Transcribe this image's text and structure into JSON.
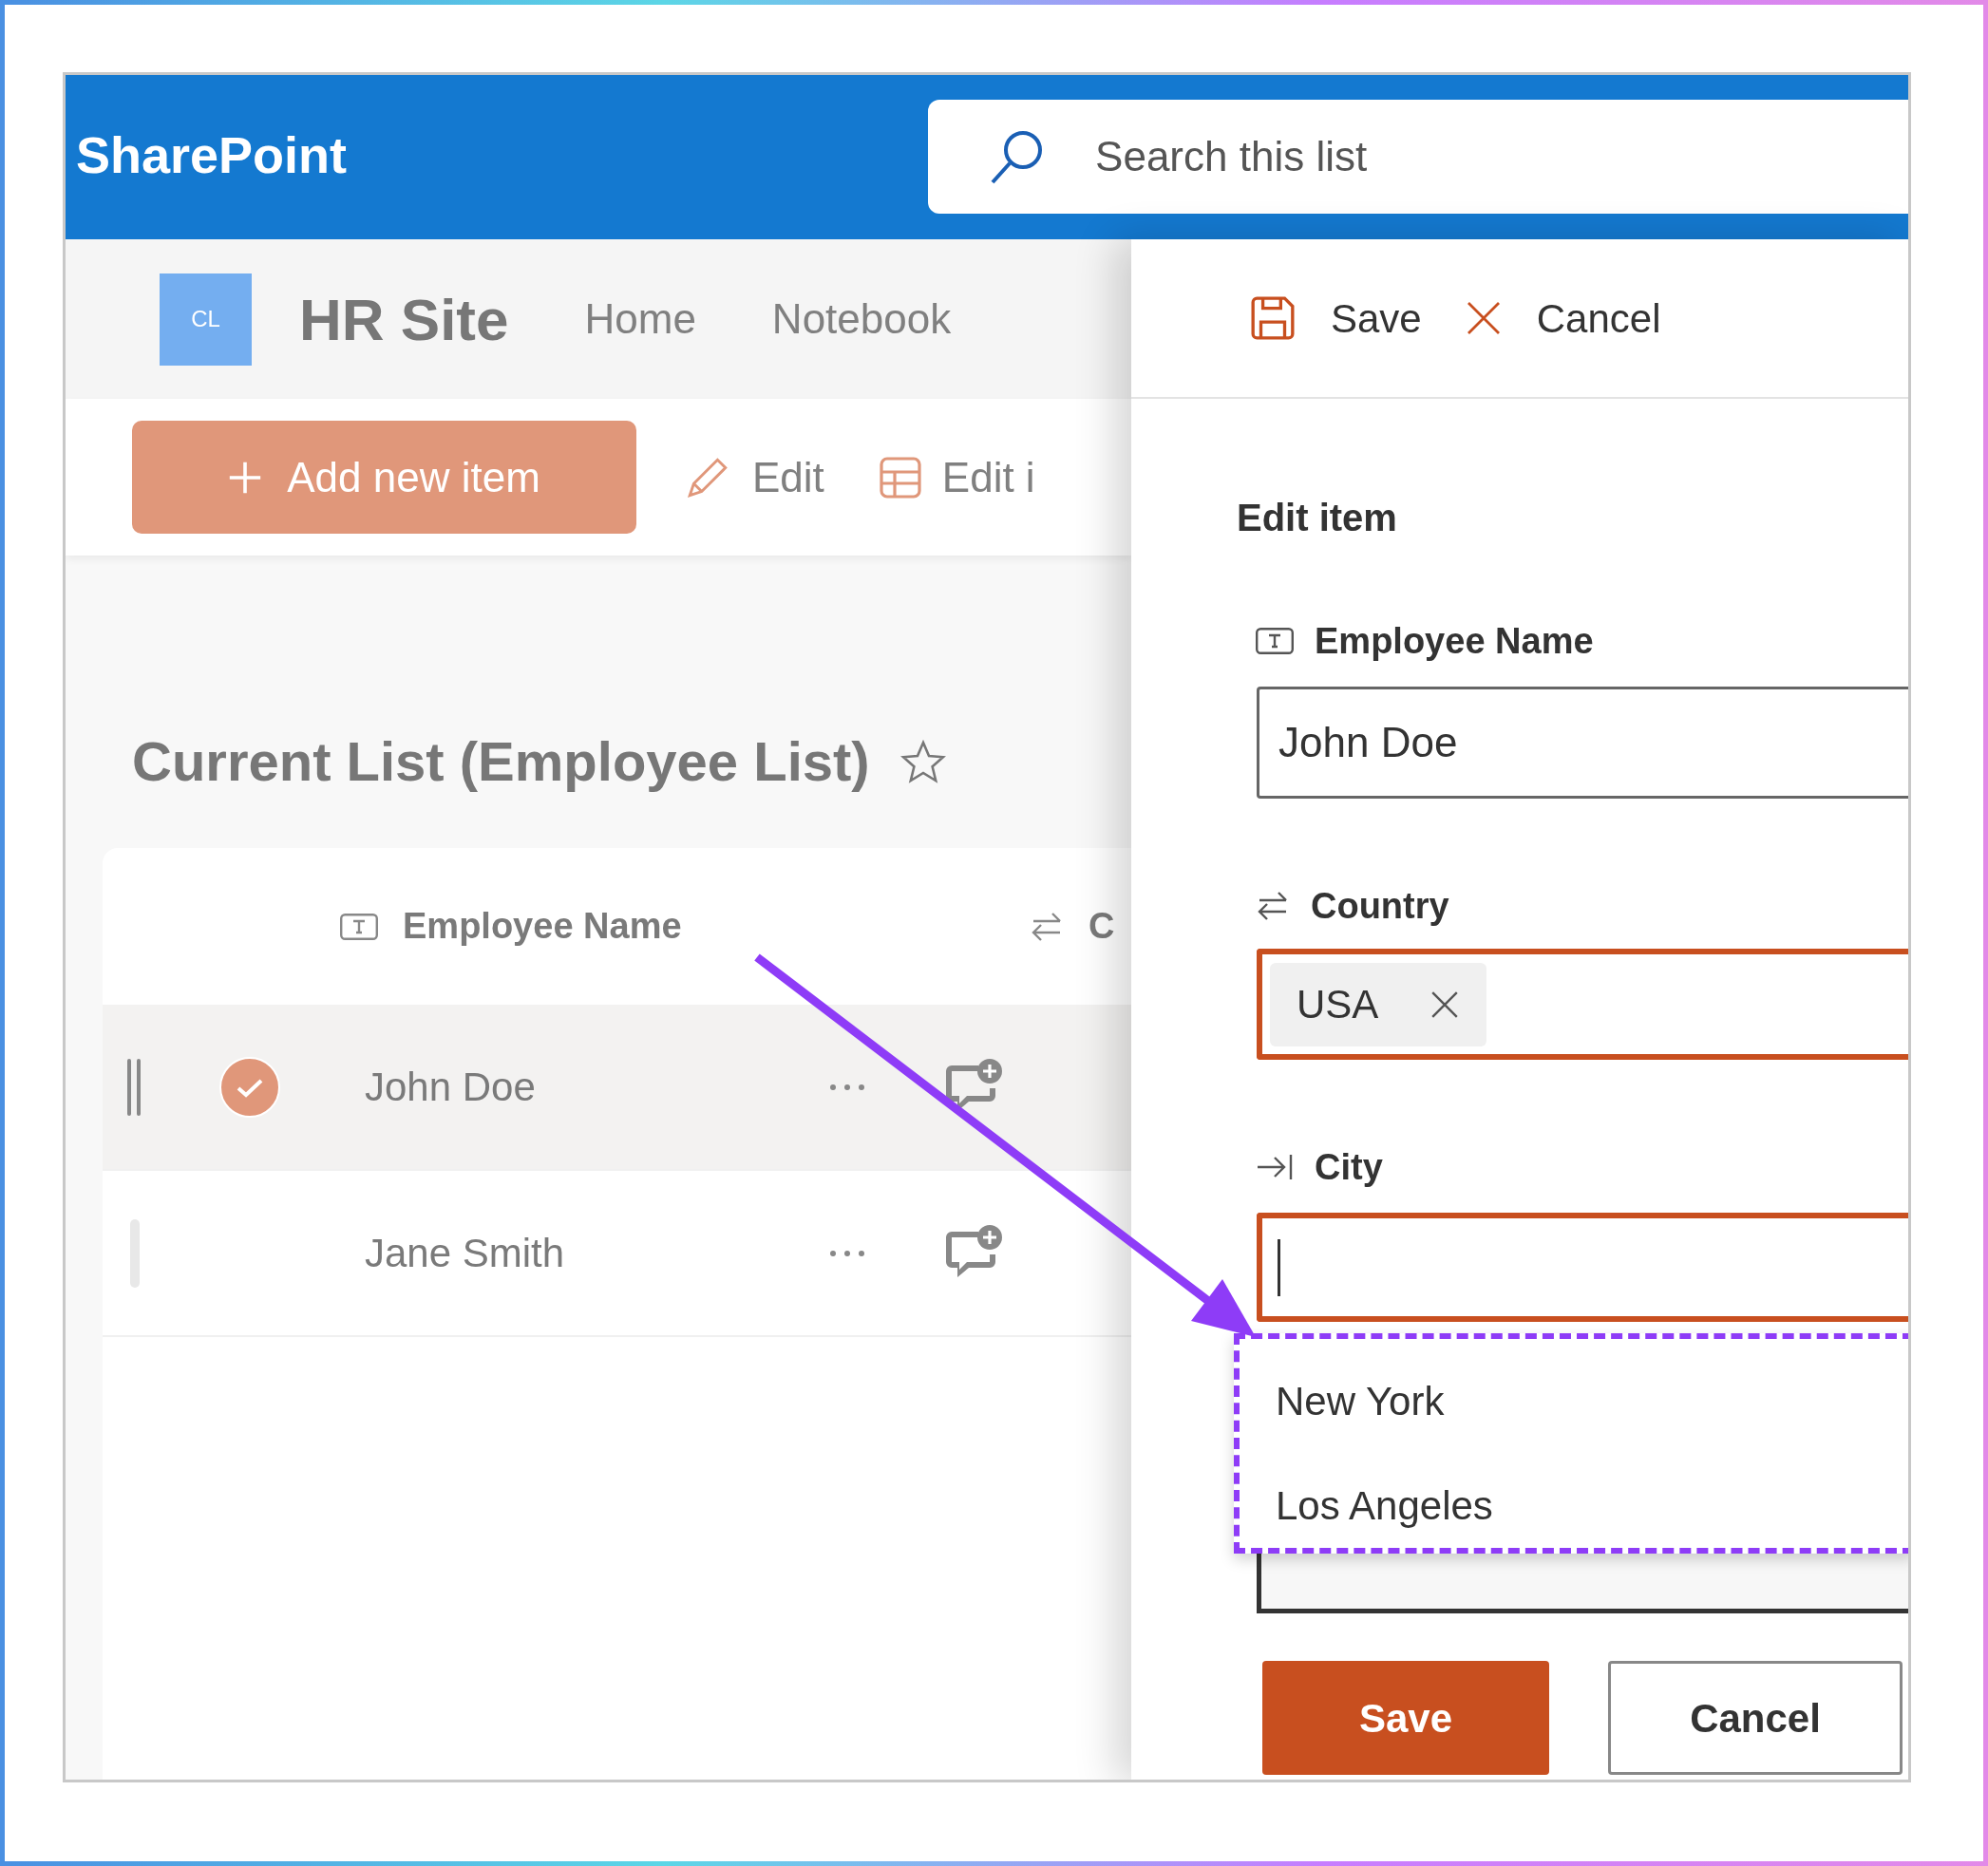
{
  "header": {
    "app_title": "SharePoint",
    "search": {
      "placeholder": "Search this list"
    }
  },
  "site": {
    "logo": "CL",
    "title": "HR Site",
    "nav": [
      {
        "label": "Home"
      },
      {
        "label": "Notebook"
      }
    ]
  },
  "command_bar": [
    {
      "kind": "add",
      "label": "Add new item"
    },
    {
      "kind": "edit",
      "label": "Edit"
    },
    {
      "kind": "grid",
      "label": "Edit i"
    }
  ],
  "list": {
    "title": "Current List (Employee List)",
    "favorite": false,
    "columns": [
      {
        "kind": "text",
        "label": "Employee Name"
      },
      {
        "kind": "choice",
        "label": "C"
      }
    ],
    "rows": [
      {
        "name": "John Doe",
        "selected": true
      },
      {
        "name": "Jane Smith",
        "selected": false
      }
    ]
  },
  "panel": {
    "commands": [
      {
        "kind": "save",
        "label": "Save"
      },
      {
        "kind": "cancel",
        "label": "Cancel"
      }
    ],
    "title": "Edit item",
    "fields": [
      {
        "kind": "text",
        "label": "Employee Name",
        "value": "John Doe",
        "highlighted": false
      },
      {
        "kind": "choice",
        "label": "Country",
        "tags": [
          "USA"
        ],
        "highlighted": true
      },
      {
        "kind": "lookup",
        "label": "City",
        "highlighted": true,
        "suggestions": [
          {
            "label": "New York"
          },
          {
            "label": "Los Angeles"
          }
        ]
      }
    ],
    "attachments": {
      "kind": "box"
    },
    "buttons": [
      {
        "kind": "primary",
        "label": "Save"
      },
      {
        "kind": "default",
        "label": "Cancel"
      }
    ]
  }
}
